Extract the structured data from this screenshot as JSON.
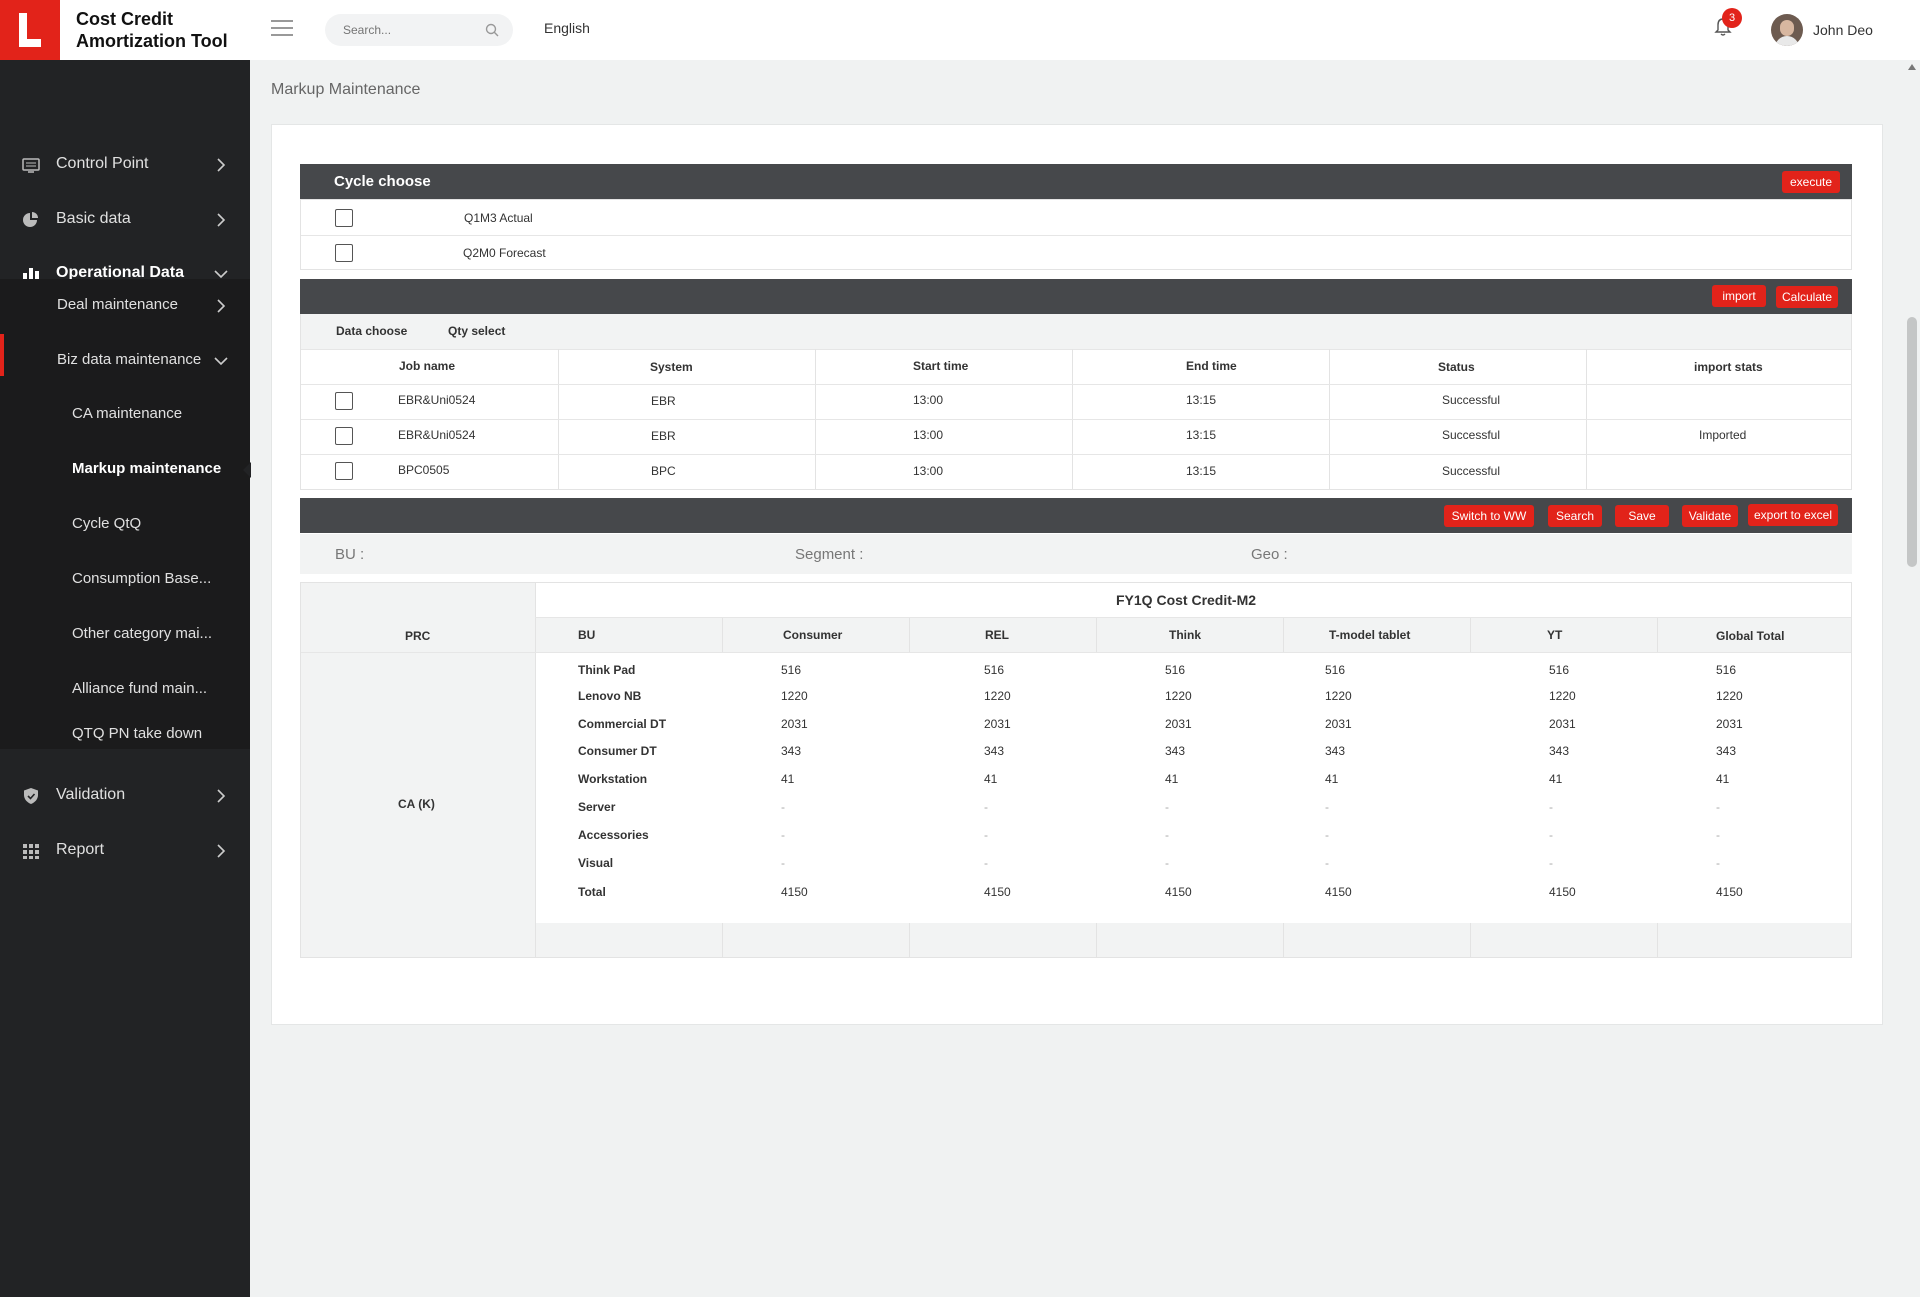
{
  "app": {
    "title_line1": "Cost Credit",
    "title_line2": "Amortization Tool"
  },
  "header": {
    "search_placeholder": "Search...",
    "language": "English",
    "notification_count": "3",
    "user_name": "John Deo"
  },
  "sidebar": {
    "items": [
      {
        "label": "Control Point",
        "icon": "monitor-icon"
      },
      {
        "label": "Basic data",
        "icon": "pie-chart-icon"
      },
      {
        "label": "Operational Data",
        "icon": "bar-chart-icon",
        "expanded": true
      },
      {
        "label": "Validation",
        "icon": "shield-icon"
      },
      {
        "label": "Report",
        "icon": "grid-icon"
      }
    ],
    "sub_items": [
      {
        "label": "Deal maintenance"
      },
      {
        "label": "Biz data maintenance",
        "expanded": true
      }
    ],
    "sub2_items": [
      {
        "label": "CA maintenance"
      },
      {
        "label": "Markup maintenance",
        "active": true
      },
      {
        "label": "Cycle QtQ"
      },
      {
        "label": "Consumption Base..."
      },
      {
        "label": "Other category mai..."
      },
      {
        "label": "Alliance fund main..."
      },
      {
        "label": "QTQ PN take down"
      }
    ]
  },
  "page": {
    "title": "Markup Maintenance"
  },
  "cycle": {
    "title": "Cycle choose",
    "execute_label": "execute",
    "options": [
      "Q1M3 Actual",
      "Q2M0 Forecast"
    ]
  },
  "jobs": {
    "import_label": "import",
    "calculate_label": "Calculate",
    "tabs": [
      "Data choose",
      "Qty select"
    ],
    "columns": [
      "Job name",
      "System",
      "Start time",
      "End time",
      "Status",
      "import stats"
    ],
    "rows": [
      {
        "job": "EBR&Uni0524",
        "system": "EBR",
        "start": "13:00",
        "end": "13:15",
        "status": "Successful",
        "import_stats": ""
      },
      {
        "job": "EBR&Uni0524",
        "system": "EBR",
        "start": "13:00",
        "end": "13:15",
        "status": "Successful",
        "import_stats": "Imported"
      },
      {
        "job": "BPC0505",
        "system": "BPC",
        "start": "13:00",
        "end": "13:15",
        "status": "Successful",
        "import_stats": ""
      }
    ]
  },
  "actions": {
    "switch_label": "Switch to WW",
    "search_label": "Search",
    "save_label": "Save",
    "validate_label": "Validate",
    "export_label": "export to excel"
  },
  "filters": {
    "bu": "BU :",
    "segment": "Segment :",
    "geo": "Geo :"
  },
  "result": {
    "group_title": "FY1Q Cost Credit-M2",
    "prc_header": "PRC",
    "prc_value": "CA (K)",
    "columns": [
      "BU",
      "Consumer",
      "REL",
      "Think",
      "T-model tablet",
      "YT",
      "Global Total"
    ],
    "rows": [
      {
        "bu": "Think Pad",
        "values": [
          "516",
          "516",
          "516",
          "516",
          "516",
          "516"
        ]
      },
      {
        "bu": "Lenovo NB",
        "values": [
          "1220",
          "1220",
          "1220",
          "1220",
          "1220",
          "1220"
        ]
      },
      {
        "bu": "Commercial DT",
        "values": [
          "2031",
          "2031",
          "2031",
          "2031",
          "2031",
          "2031"
        ]
      },
      {
        "bu": "Consumer DT",
        "values": [
          "343",
          "343",
          "343",
          "343",
          "343",
          "343"
        ]
      },
      {
        "bu": "Workstation",
        "values": [
          "41",
          "41",
          "41",
          "41",
          "41",
          "41"
        ]
      },
      {
        "bu": "Server",
        "values": [
          "-",
          "-",
          "-",
          "-",
          "-",
          "-"
        ]
      },
      {
        "bu": "Accessories",
        "values": [
          "-",
          "-",
          "-",
          "-",
          "-",
          "-"
        ]
      },
      {
        "bu": "Visual",
        "values": [
          "-",
          "-",
          "-",
          "-",
          "-",
          "-"
        ]
      },
      {
        "bu": "Total",
        "values": [
          "4150",
          "4150",
          "4150",
          "4150",
          "4150",
          "4150"
        ]
      }
    ]
  },
  "colors": {
    "accent": "#e2231a",
    "sidebar": "#222325",
    "bar": "#46484b"
  }
}
